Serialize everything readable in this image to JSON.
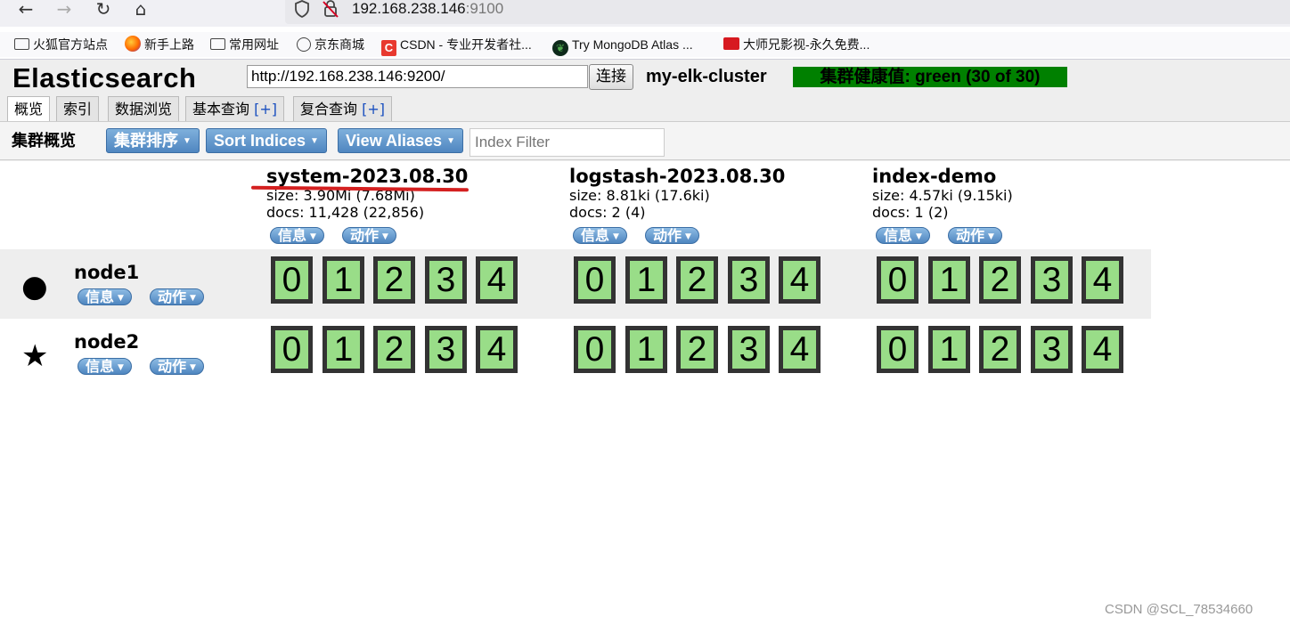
{
  "browser": {
    "url_host": "192.168.238.146",
    "url_port": ":9100",
    "bookmarks": [
      {
        "label": "火狐官方站点",
        "icon": "folder-icon"
      },
      {
        "label": "新手上路",
        "icon": "firefox-icon"
      },
      {
        "label": "常用网址",
        "icon": "folder-icon"
      },
      {
        "label": "京东商城",
        "icon": "globe-icon"
      },
      {
        "label": "CSDN - 专业开发者社...",
        "icon": "csdn-icon"
      },
      {
        "label": "Try MongoDB Atlas ...",
        "icon": "mongodb-icon"
      },
      {
        "label": "大师兄影视-永久免费...",
        "icon": "film-icon"
      }
    ]
  },
  "app": {
    "title": "Elasticsearch",
    "connect_url": "http://192.168.238.146:9200/",
    "connect_label": "连接",
    "cluster_name": "my-elk-cluster",
    "health": "集群健康值: green (30 of 30)",
    "health_color": "#008000"
  },
  "tabs": [
    {
      "label": "概览",
      "plus": ""
    },
    {
      "label": "索引",
      "plus": ""
    },
    {
      "label": "数据浏览",
      "plus": ""
    },
    {
      "label": "基本查询 ",
      "plus": "[+]"
    },
    {
      "label": "复合查询 ",
      "plus": "[+]"
    }
  ],
  "toolbar": {
    "title": "集群概览",
    "sort_cluster": "集群排序",
    "sort_indices": "Sort Indices",
    "view_aliases": "View Aliases",
    "filter_placeholder": "Index Filter"
  },
  "menu": {
    "info": "信息",
    "action": "动作"
  },
  "indices": [
    {
      "name": "system-2023.08.30",
      "size": "size: 3.90Mi (7.68Mi)",
      "docs": "docs: 11,428 (22,856)"
    },
    {
      "name": "logstash-2023.08.30",
      "size": "size: 8.81ki (17.6ki)",
      "docs": "docs: 2 (4)"
    },
    {
      "name": "index-demo",
      "size": "size: 4.57ki (9.15ki)",
      "docs": "docs: 1 (2)"
    }
  ],
  "nodes": [
    {
      "name": "node1",
      "icon": "●",
      "icon_name": "master-dot-icon",
      "primary_shards": [
        1,
        3
      ]
    },
    {
      "name": "node2",
      "icon": "★",
      "icon_name": "master-star-icon",
      "primary_shards": [
        0,
        2,
        4
      ]
    }
  ],
  "shards": [
    "0",
    "1",
    "2",
    "3",
    "4"
  ],
  "shard_color": "#99dd88",
  "watermark": "CSDN @SCL_78534660"
}
